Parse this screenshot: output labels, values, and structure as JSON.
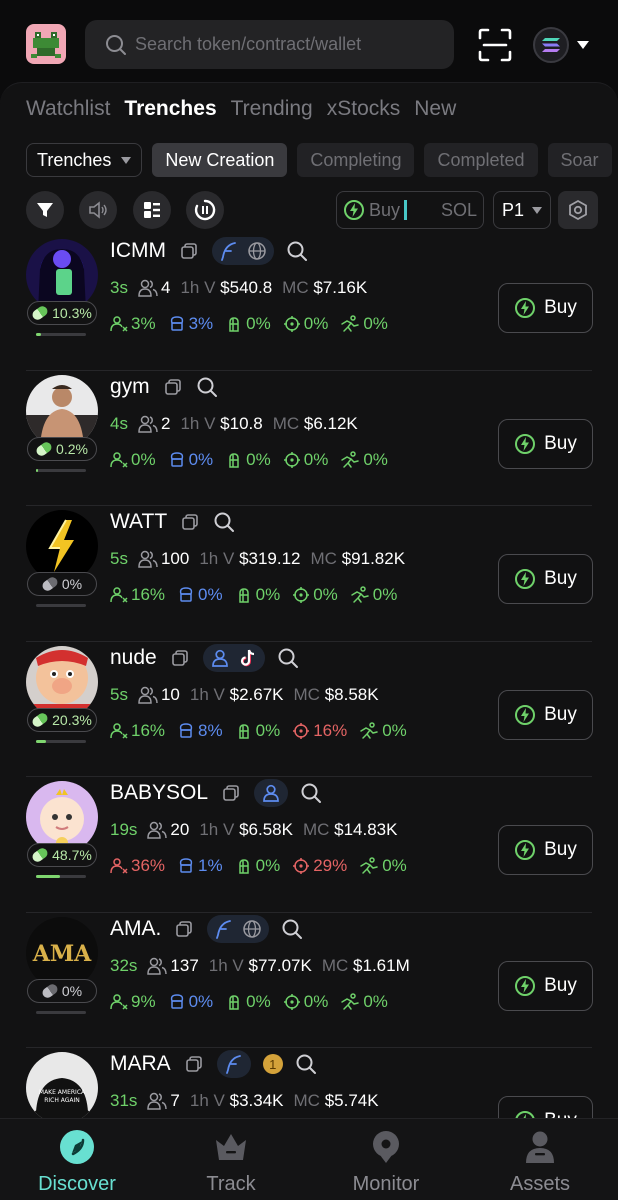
{
  "search": {
    "placeholder": "Search token/contract/wallet"
  },
  "main_tabs": [
    {
      "label": "Watchlist",
      "active": false
    },
    {
      "label": "Trenches",
      "active": true
    },
    {
      "label": "Trending",
      "active": false
    },
    {
      "label": "xStocks",
      "active": false
    },
    {
      "label": "New",
      "active": false
    }
  ],
  "filters": {
    "dropdown": "Trenches",
    "chips": [
      {
        "label": "New Creation",
        "active": true
      },
      {
        "label": "Completing",
        "active": false
      },
      {
        "label": "Completed",
        "active": false
      },
      {
        "label": "Soar",
        "active": false
      }
    ]
  },
  "toolbar": {
    "buy_label": "Buy",
    "currency": "SOL",
    "preset": "P1"
  },
  "labels": {
    "volume": "1h V",
    "market_cap": "MC",
    "buy": "Buy"
  },
  "tokens": [
    {
      "name": "ICMM",
      "age": "3s",
      "holders": "4",
      "volume": "$540.8",
      "mc": "$7.16K",
      "progress_pct": "10.3%",
      "progress": 0.103,
      "stats": [
        "3%",
        "3%",
        "0%",
        "0%",
        "0%"
      ],
      "stat_colors": [
        "g",
        "b",
        "g",
        "g",
        "g"
      ],
      "pill_color": "green",
      "socials": [
        "feather-icon",
        "globe-icon"
      ],
      "avatar_color": "#2a1b5e"
    },
    {
      "name": "gym",
      "age": "4s",
      "holders": "2",
      "volume": "$10.8",
      "mc": "$6.12K",
      "progress_pct": "0.2%",
      "progress": 0.002,
      "stats": [
        "0%",
        "0%",
        "0%",
        "0%",
        "0%"
      ],
      "stat_colors": [
        "g",
        "b",
        "g",
        "g",
        "g"
      ],
      "pill_color": "green",
      "socials": [],
      "avatar_color": "#8a6e5a"
    },
    {
      "name": "WATT",
      "age": "5s",
      "holders": "100",
      "volume": "$319.12",
      "mc": "$91.82K",
      "progress_pct": "0%",
      "progress": 0,
      "stats": [
        "16%",
        "0%",
        "0%",
        "0%",
        "0%"
      ],
      "stat_colors": [
        "g",
        "b",
        "g",
        "g",
        "g"
      ],
      "pill_color": "grey",
      "socials": [],
      "avatar_color": "#000000"
    },
    {
      "name": "nude",
      "age": "5s",
      "holders": "10",
      "volume": "$2.67K",
      "mc": "$8.58K",
      "progress_pct": "20.3%",
      "progress": 0.203,
      "stats": [
        "16%",
        "8%",
        "0%",
        "16%",
        "0%"
      ],
      "stat_colors": [
        "g",
        "b",
        "g",
        "r",
        "g"
      ],
      "pill_color": "green",
      "socials": [
        "user-icon",
        "tiktok-icon"
      ],
      "avatar_color": "#c9874f"
    },
    {
      "name": "BABYSOL",
      "age": "19s",
      "holders": "20",
      "volume": "$6.58K",
      "mc": "$14.83K",
      "progress_pct": "48.7%",
      "progress": 0.487,
      "stats": [
        "36%",
        "1%",
        "0%",
        "29%",
        "0%"
      ],
      "stat_colors": [
        "r",
        "b",
        "g",
        "r",
        "g"
      ],
      "pill_color": "green",
      "socials": [
        "user-icon"
      ],
      "avatar_color": "#d9b8ef"
    },
    {
      "name": "AMA.",
      "age": "32s",
      "holders": "137",
      "volume": "$77.07K",
      "mc": "$1.61M",
      "progress_pct": "0%",
      "progress": 0,
      "stats": [
        "9%",
        "0%",
        "0%",
        "0%",
        "0%"
      ],
      "stat_colors": [
        "g",
        "b",
        "g",
        "g",
        "g"
      ],
      "pill_color": "grey",
      "socials": [
        "feather-icon",
        "globe-icon"
      ],
      "avatar_color": "#0c0c0c",
      "avatar_text": "AMA"
    },
    {
      "name": "MARA",
      "age": "31s",
      "holders": "7",
      "volume": "$3.34K",
      "mc": "$5.74K",
      "progress_pct": "",
      "progress": 0,
      "stats": [],
      "stat_colors": [],
      "pill_color": "grey",
      "socials": [
        "feather-icon"
      ],
      "avatar_color": "#e8e8e8",
      "avatar_text": "MAKE AMERICA RICH AGAIN",
      "badge": "1"
    }
  ],
  "nav": [
    {
      "label": "Discover",
      "icon": "compass-icon",
      "active": true
    },
    {
      "label": "Track",
      "icon": "crown-icon",
      "active": false
    },
    {
      "label": "Monitor",
      "icon": "location-icon",
      "active": false
    },
    {
      "label": "Assets",
      "icon": "person-icon",
      "active": false
    }
  ]
}
